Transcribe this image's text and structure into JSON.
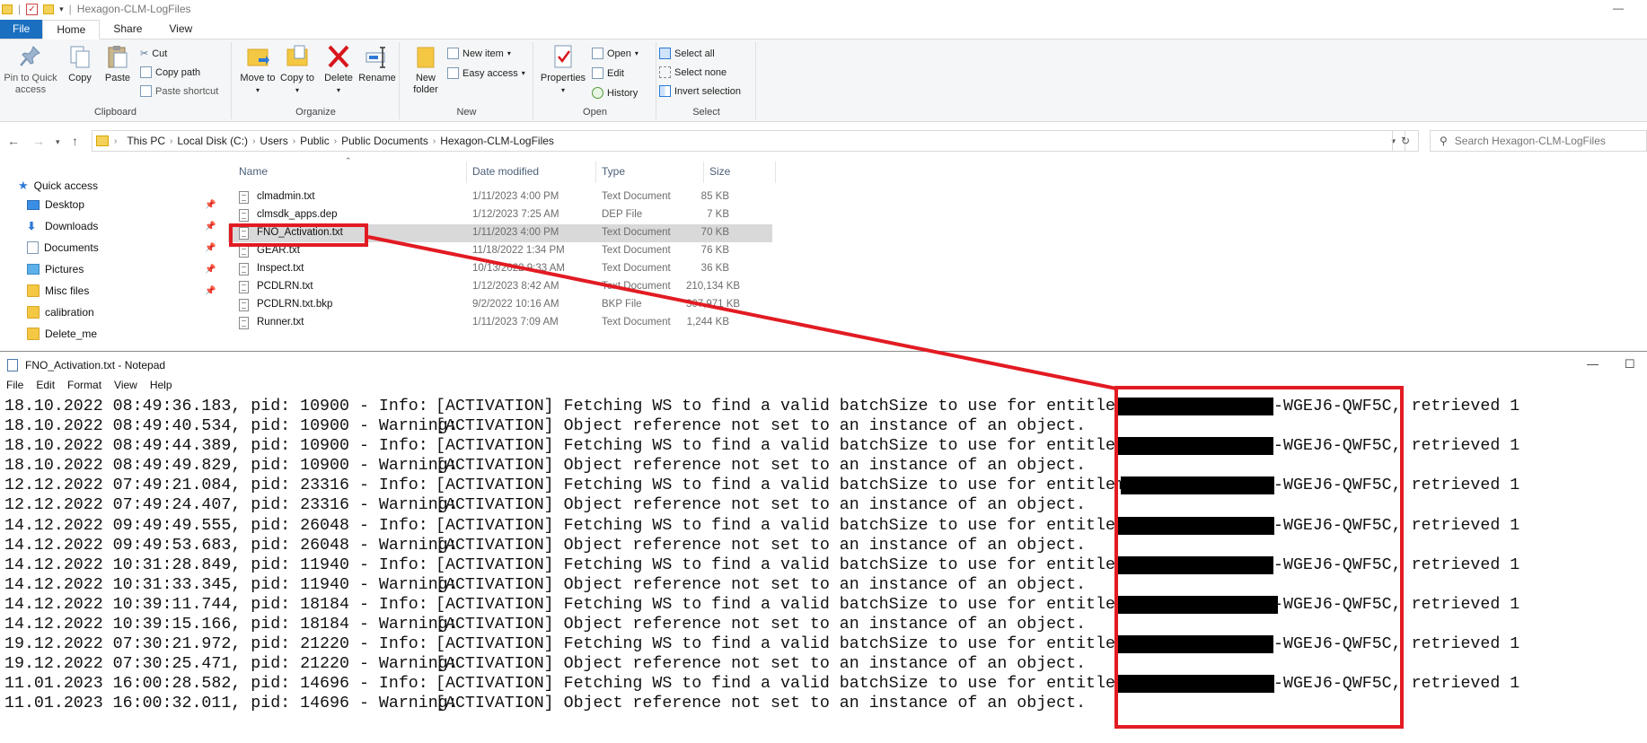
{
  "window": {
    "title": "Hexagon-CLM-LogFiles",
    "minimize_glyph": "—"
  },
  "ribbon_tabs": [
    "File",
    "Home",
    "Share",
    "View"
  ],
  "ribbon": {
    "clipboard": {
      "label": "Clipboard",
      "pin": "Pin to Quick access",
      "copy": "Copy",
      "paste": "Paste",
      "cut": "Cut",
      "copy_path": "Copy path",
      "paste_shortcut": "Paste shortcut"
    },
    "organize": {
      "label": "Organize",
      "move_to": "Move to",
      "copy_to": "Copy to",
      "delete": "Delete",
      "rename": "Rename"
    },
    "new": {
      "label": "New",
      "new_folder": "New folder",
      "new_item": "New item",
      "easy_access": "Easy access"
    },
    "open": {
      "label": "Open",
      "properties": "Properties",
      "open": "Open",
      "edit": "Edit",
      "history": "History"
    },
    "select": {
      "label": "Select",
      "select_all": "Select all",
      "select_none": "Select none",
      "invert_selection": "Invert selection"
    }
  },
  "address": {
    "crumbs": [
      "This PC",
      "Local Disk (C:)",
      "Users",
      "Public",
      "Public Documents",
      "Hexagon-CLM-LogFiles"
    ],
    "search_placeholder": "Search Hexagon-CLM-LogFiles"
  },
  "nav": {
    "quick_access": "Quick access",
    "items": [
      "Desktop",
      "Downloads",
      "Documents",
      "Pictures",
      "Misc files",
      "calibration",
      "Delete_me"
    ]
  },
  "columns": {
    "name": "Name",
    "date": "Date modified",
    "type": "Type",
    "size": "Size"
  },
  "files": [
    {
      "name": "clmadmin.txt",
      "date": "1/11/2023 4:00 PM",
      "type": "Text Document",
      "size": "85 KB"
    },
    {
      "name": "clmsdk_apps.dep",
      "date": "1/12/2023 7:25 AM",
      "type": "DEP File",
      "size": "7 KB"
    },
    {
      "name": "FNO_Activation.txt",
      "date": "1/11/2023 4:00 PM",
      "type": "Text Document",
      "size": "70 KB"
    },
    {
      "name": "GEAR.txt",
      "date": "11/18/2022 1:34 PM",
      "type": "Text Document",
      "size": "76 KB"
    },
    {
      "name": "Inspect.txt",
      "date": "10/13/2022 9:33 AM",
      "type": "Text Document",
      "size": "36 KB"
    },
    {
      "name": "PCDLRN.txt",
      "date": "1/12/2023 8:42 AM",
      "type": "Text Document",
      "size": "210,134 KB"
    },
    {
      "name": "PCDLRN.txt.bkp",
      "date": "9/2/2022 10:16 AM",
      "type": "BKP File",
      "size": "307,971 KB"
    },
    {
      "name": "Runner.txt",
      "date": "1/11/2023 7:09 AM",
      "type": "Text Document",
      "size": "1,244 KB"
    }
  ],
  "notepad": {
    "title": "FNO_Activation.txt - Notepad",
    "menu": [
      "File",
      "Edit",
      "Format",
      "View",
      "Help"
    ],
    "controls": {
      "minimize": "—",
      "maximize": "☐"
    },
    "lines": [
      {
        "prefix": "18.10.2022 08:49:36.183, pid: 10900 - Info:    ",
        "msg": "[ACTIVATION] Fetching WS to find a valid batchSize to use for entitlementId:",
        "suffix": "-WGEJ6-QWF5C, retrieved 1"
      },
      {
        "prefix": "18.10.2022 08:49:40.534, pid: 10900 - Warning: ",
        "msg": "[ACTIVATION] Object reference not set to an instance of an object.",
        "suffix": ""
      },
      {
        "prefix": "18.10.2022 08:49:44.389, pid: 10900 - Info:    ",
        "msg": "[ACTIVATION] Fetching WS to find a valid batchSize to use for entitlementId:",
        "suffix": "-WGEJ6-QWF5C, retrieved 1"
      },
      {
        "prefix": "18.10.2022 08:49:49.829, pid: 10900 - Warning: ",
        "msg": "[ACTIVATION] Object reference not set to an instance of an object.",
        "suffix": ""
      },
      {
        "prefix": "12.12.2022 07:49:21.084, pid: 23316 - Info:    ",
        "msg": "[ACTIVATION] Fetching WS to find a valid batchSize to use for entitlementId:",
        "suffix": "-WGEJ6-QWF5C, retrieved 1"
      },
      {
        "prefix": "12.12.2022 07:49:24.407, pid: 23316 - Warning: ",
        "msg": "[ACTIVATION] Object reference not set to an instance of an object.",
        "suffix": ""
      },
      {
        "prefix": "14.12.2022 09:49:49.555, pid: 26048 - Info:    ",
        "msg": "[ACTIVATION] Fetching WS to find a valid batchSize to use for entitlementId:",
        "suffix": "-WGEJ6-QWF5C, retrieved 1"
      },
      {
        "prefix": "14.12.2022 09:49:53.683, pid: 26048 - Warning: ",
        "msg": "[ACTIVATION] Object reference not set to an instance of an object.",
        "suffix": ""
      },
      {
        "prefix": "14.12.2022 10:31:28.849, pid: 11940 - Info:    ",
        "msg": "[ACTIVATION] Fetching WS to find a valid batchSize to use for entitlementId:",
        "suffix": "-WGEJ6-QWF5C, retrieved 1"
      },
      {
        "prefix": "14.12.2022 10:31:33.345, pid: 11940 - Warning: ",
        "msg": "[ACTIVATION] Object reference not set to an instance of an object.",
        "suffix": ""
      },
      {
        "prefix": "14.12.2022 10:39:11.744, pid: 18184 - Info:    ",
        "msg": "[ACTIVATION] Fetching WS to find a valid batchSize to use for entitlementId:",
        "suffix": "-WGEJ6-QWF5C, retrieved 1"
      },
      {
        "prefix": "14.12.2022 10:39:15.166, pid: 18184 - Warning: ",
        "msg": "[ACTIVATION] Object reference not set to an instance of an object.",
        "suffix": ""
      },
      {
        "prefix": "19.12.2022 07:30:21.972, pid: 21220 - Info:    ",
        "msg": "[ACTIVATION] Fetching WS to find a valid batchSize to use for entitlementId:",
        "suffix": "-WGEJ6-QWF5C, retrieved 1"
      },
      {
        "prefix": "19.12.2022 07:30:25.471, pid: 21220 - Warning: ",
        "msg": "[ACTIVATION] Object reference not set to an instance of an object.",
        "suffix": ""
      },
      {
        "prefix": "11.01.2023 16:00:28.582, pid: 14696 - Info:    ",
        "msg": "[ACTIVATION] Fetching WS to find a valid batchSize to use for entitlementId:",
        "suffix": "-WGEJ6-QWF5C, retrieved 1"
      },
      {
        "prefix": "11.01.2023 16:00:32.011, pid: 14696 - Warning: ",
        "msg": "[ACTIVATION] Object reference not set to an instance of an object.",
        "suffix": ""
      }
    ]
  },
  "annotation_color": "#e21b23"
}
